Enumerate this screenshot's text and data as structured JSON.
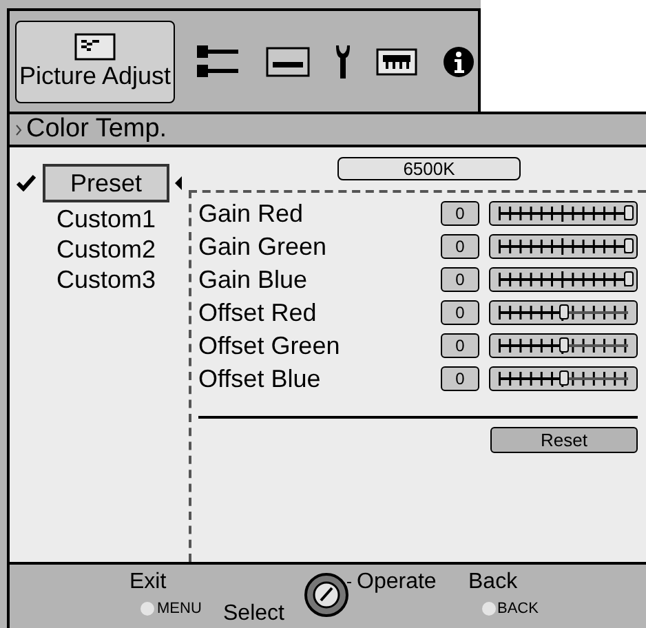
{
  "tabs": [
    {
      "kind": "picture",
      "label": "Picture Adjust",
      "selected": true
    },
    {
      "kind": "connector",
      "selected": false
    },
    {
      "kind": "screen",
      "selected": false
    },
    {
      "kind": "wrench",
      "selected": false
    },
    {
      "kind": "network",
      "selected": false
    },
    {
      "kind": "info",
      "selected": false
    }
  ],
  "section_title": "Color Temp.",
  "presets": [
    {
      "label": "Preset",
      "selected": true,
      "checked": true
    },
    {
      "label": "Custom1",
      "selected": false,
      "checked": false
    },
    {
      "label": "Custom2",
      "selected": false,
      "checked": false
    },
    {
      "label": "Custom3",
      "selected": false,
      "checked": false
    }
  ],
  "temperature": "6500K",
  "adjustments": [
    {
      "label": "Gain Red",
      "value": "0",
      "level": 1.0
    },
    {
      "label": "Gain Green",
      "value": "0",
      "level": 1.0
    },
    {
      "label": "Gain Blue",
      "value": "0",
      "level": 1.0
    },
    {
      "label": "Offset Red",
      "value": "0",
      "level": 0.5
    },
    {
      "label": "Offset Green",
      "value": "0",
      "level": 0.5
    },
    {
      "label": "Offset Blue",
      "value": "0",
      "level": 0.5
    }
  ],
  "reset_button": "Reset",
  "footer": {
    "exit": "Exit",
    "menu_key": "MENU",
    "select": "Select",
    "operate": "Operate",
    "back": "Back",
    "back_key": "BACK"
  }
}
